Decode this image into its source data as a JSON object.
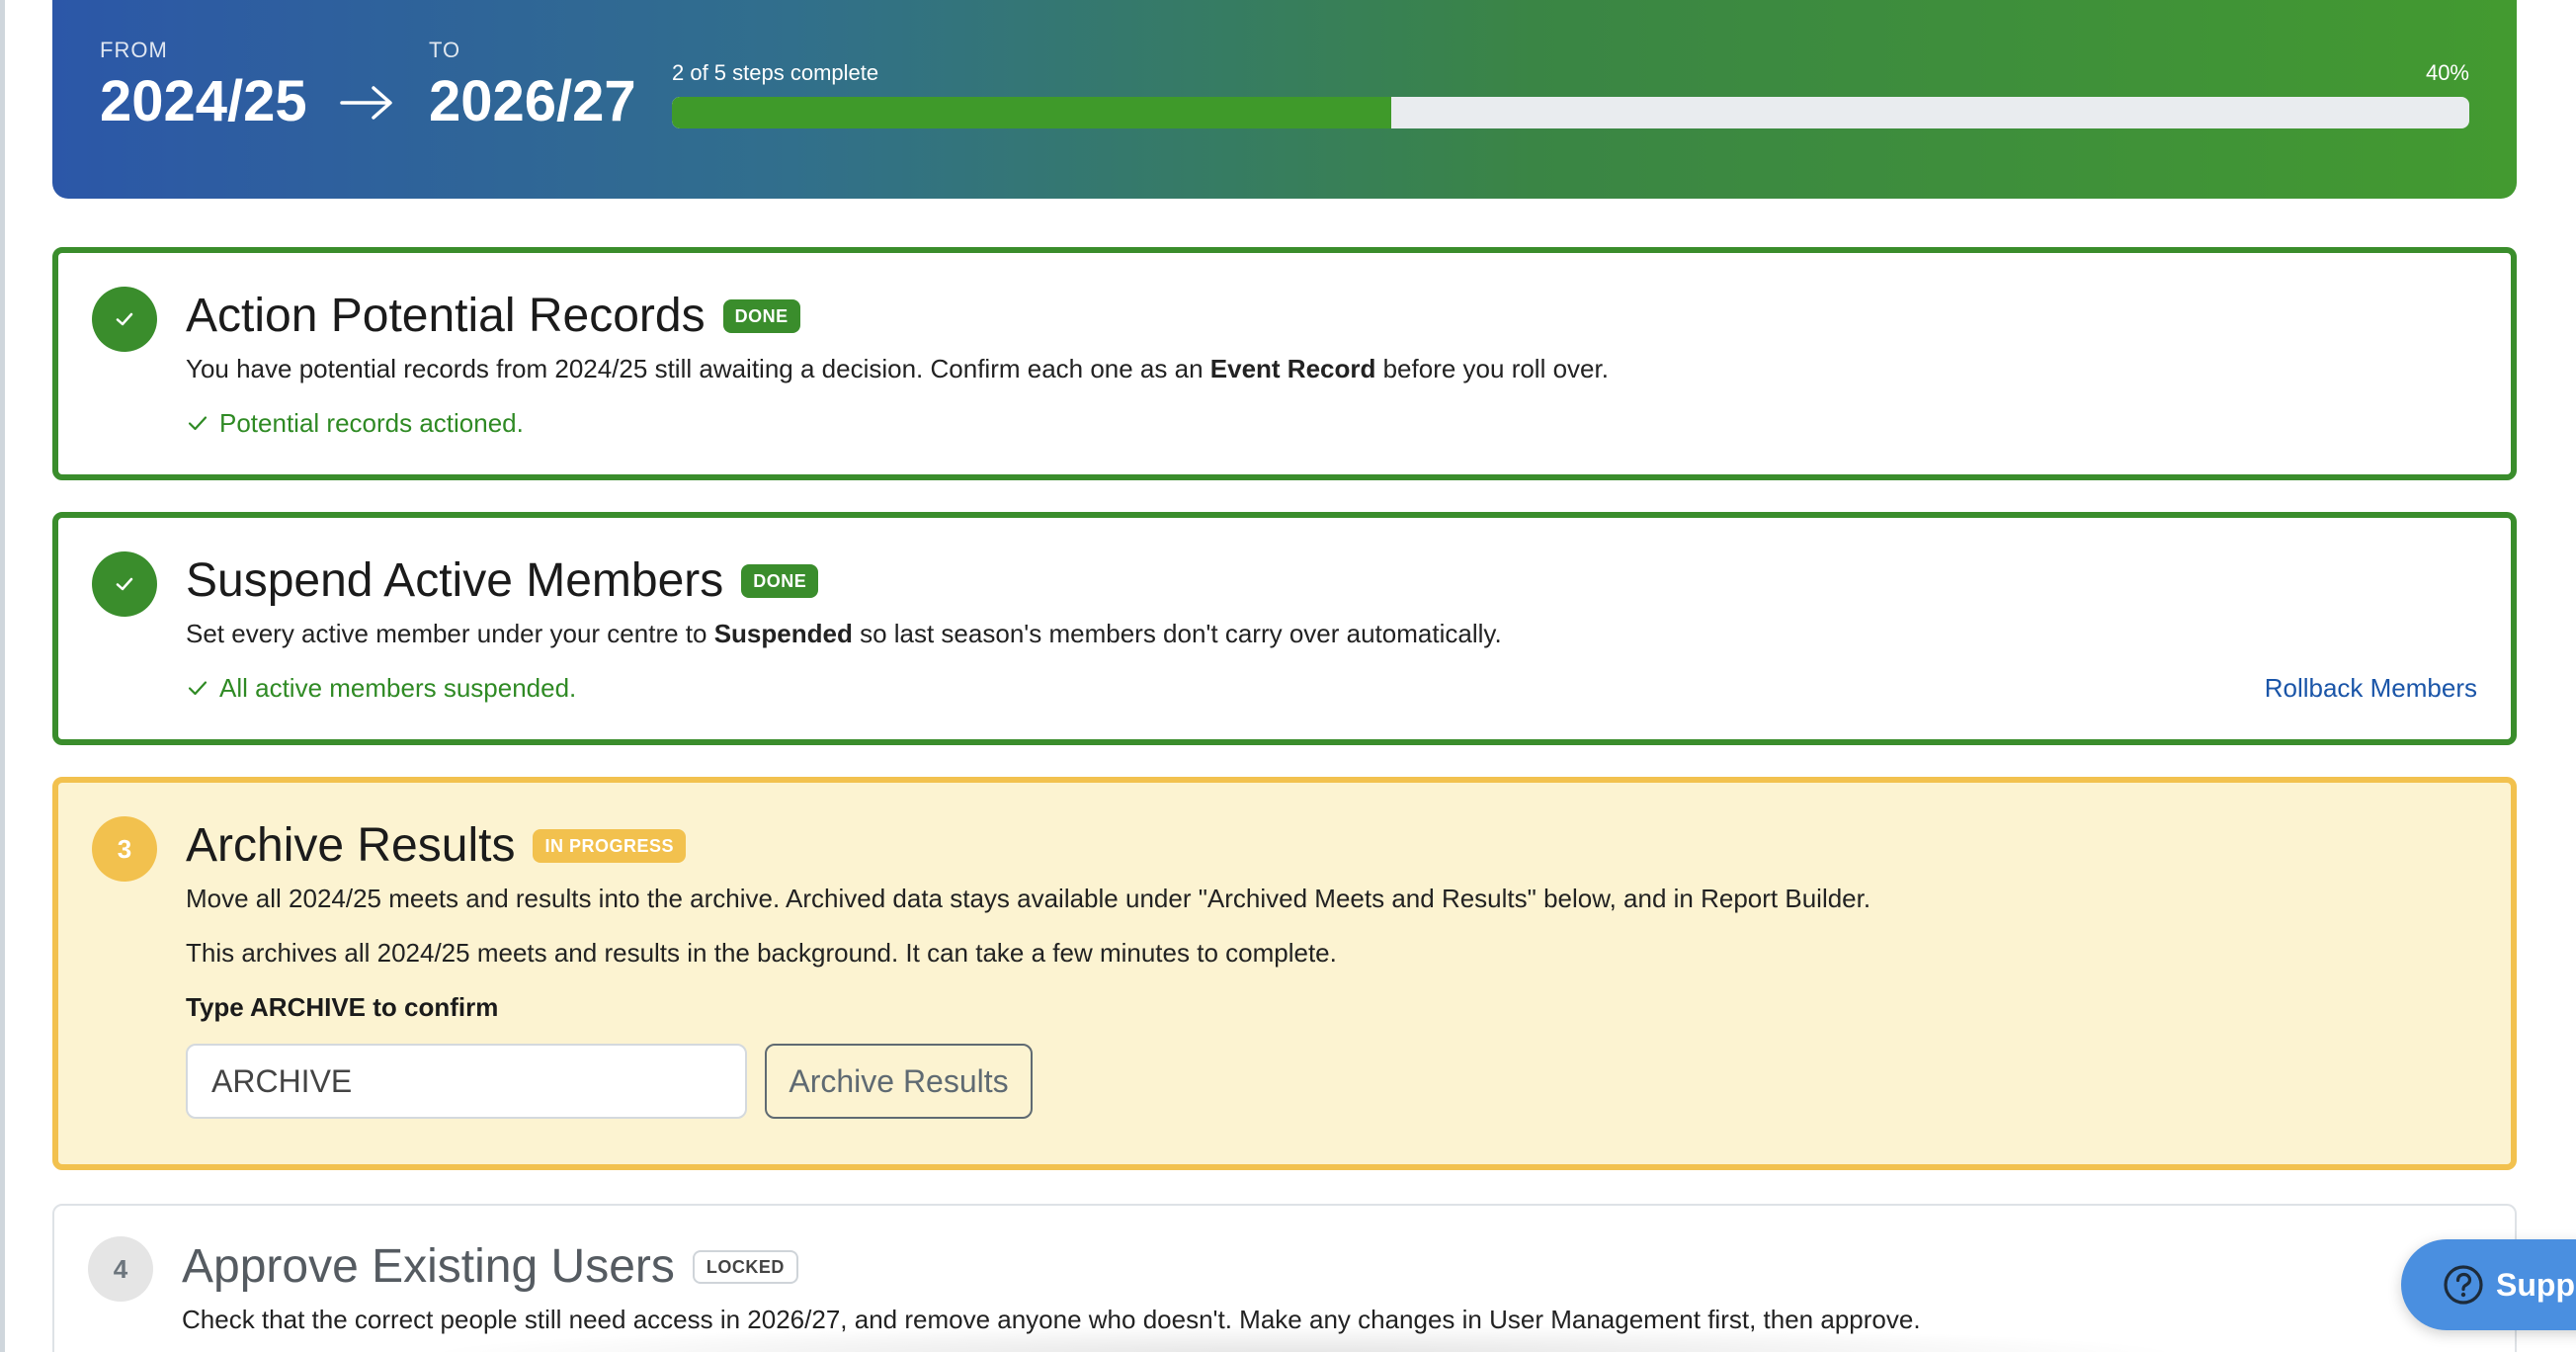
{
  "header": {
    "from_label": "FROM",
    "from_value": "2024/25",
    "to_label": "TO",
    "to_value": "2026/27",
    "arrow_icon": "arrow-right-icon",
    "progress_text": "2 of 5 steps complete",
    "progress_percent_text": "40%",
    "progress_fraction": 0.4,
    "progress_fill_color": "#3f9a2a"
  },
  "steps": [
    {
      "title": "Action Potential Records",
      "badge": "DONE",
      "status": "done",
      "icon": "check-icon",
      "description": {
        "before": "You have potential records from 2024/25 still awaiting a decision. Confirm each one as an ",
        "bold": "Event Record",
        "after": " before you roll over."
      },
      "status_text": "Potential records actioned."
    },
    {
      "title": "Suspend Active Members",
      "badge": "DONE",
      "status": "done",
      "icon": "check-icon",
      "description": {
        "before": "Set every active member under your centre to ",
        "bold": "Suspended",
        "after": " so last season's members don't carry over automatically."
      },
      "status_text": "All active members suspended.",
      "action_link": "Rollback Members"
    },
    {
      "number": "3",
      "title": "Archive Results",
      "badge": "IN PROGRESS",
      "status": "in-progress",
      "description_1": "Move all 2024/25 meets and results into the archive. Archived data stays available under \"Archived Meets and Results\" below, and in Report Builder.",
      "description_2": "This archives all 2024/25 meets and results in the background. It can take a few minutes to complete.",
      "confirm_label": "Type ARCHIVE to confirm",
      "confirm_input_value": "ARCHIVE",
      "button_label": "Archive Results"
    },
    {
      "number": "4",
      "title": "Approve Existing Users",
      "badge": "LOCKED",
      "status": "locked",
      "description": "Check that the correct people still need access in 2026/27, and remove anyone who doesn't. Make any changes in User Management first, then approve."
    }
  ],
  "support": {
    "label": "Supp",
    "icon": "question-circle-icon"
  },
  "colors": {
    "done_green": "#3a8d2c",
    "progress_yellow": "#f2c14e",
    "progress_bg": "#fcf3d1",
    "link_blue": "#1a55a8",
    "support_blue": "#4a8fe0"
  }
}
